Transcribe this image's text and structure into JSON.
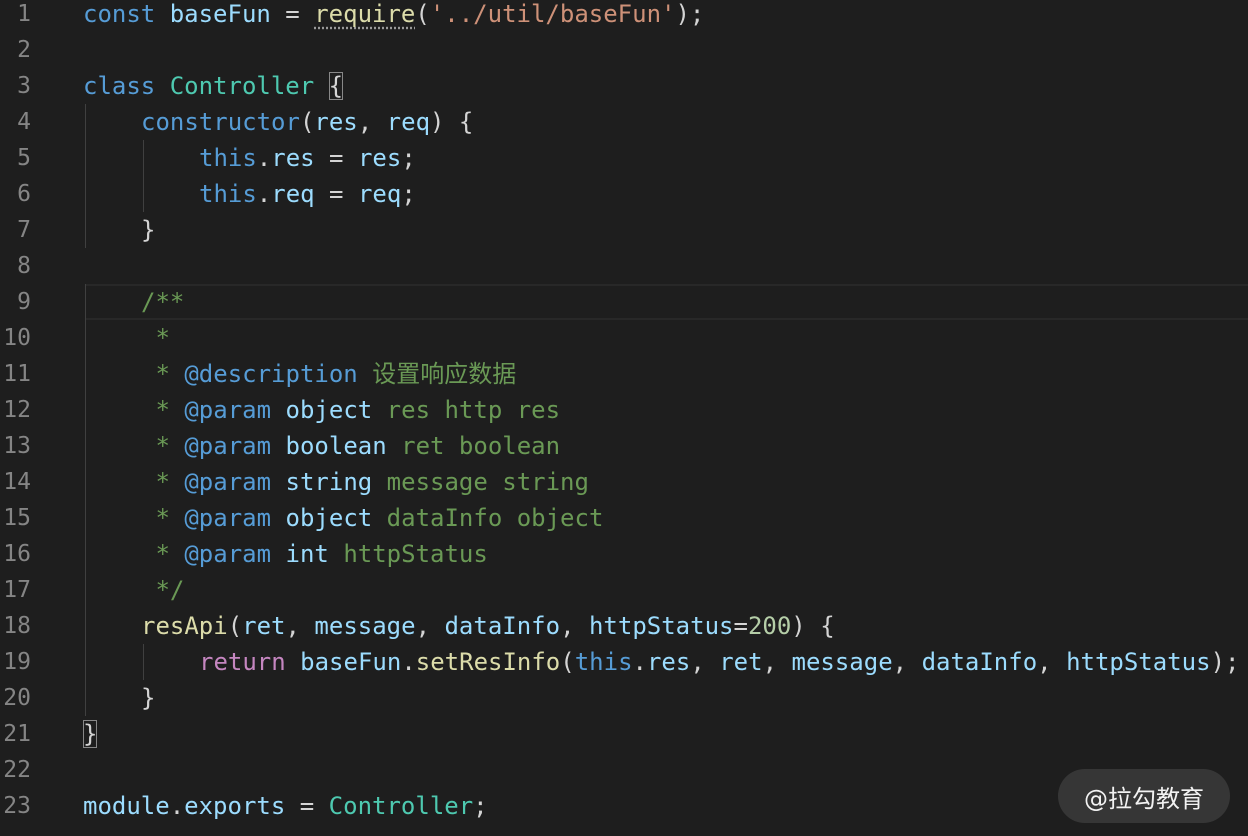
{
  "theme": {
    "background": "#1e1e1e",
    "colors": {
      "plain": "#d4d4d4",
      "keyword": "#569cd6",
      "control": "#c586c0",
      "type": "#4ec9b0",
      "function": "#dcdcaa",
      "string": "#ce9178",
      "variable": "#9cdcfe",
      "number": "#b5cea8",
      "comment": "#6a9955",
      "tag": "#569cd6"
    }
  },
  "editor": {
    "current_line": 9,
    "lines": [
      {
        "n": "1",
        "indent": 0,
        "tokens": [
          {
            "t": "const",
            "k": "keyword"
          },
          {
            "t": " ",
            "k": "plain"
          },
          {
            "t": "baseFun",
            "k": "variable"
          },
          {
            "t": " = ",
            "k": "plain"
          },
          {
            "t": "require",
            "k": "function",
            "dots": true
          },
          {
            "t": "(",
            "k": "plain"
          },
          {
            "t": "'../util/baseFun'",
            "k": "string"
          },
          {
            "t": ");",
            "k": "plain"
          }
        ]
      },
      {
        "n": "2",
        "indent": 0,
        "tokens": []
      },
      {
        "n": "3",
        "indent": 0,
        "tokens": [
          {
            "t": "class",
            "k": "keyword"
          },
          {
            "t": " ",
            "k": "plain"
          },
          {
            "t": "Controller",
            "k": "type"
          },
          {
            "t": " ",
            "k": "plain"
          },
          {
            "t": "{",
            "k": "plain",
            "box": true
          }
        ]
      },
      {
        "n": "4",
        "indent": 1,
        "tokens": [
          {
            "t": "constructor",
            "k": "keyword"
          },
          {
            "t": "(",
            "k": "plain"
          },
          {
            "t": "res",
            "k": "variable"
          },
          {
            "t": ", ",
            "k": "plain"
          },
          {
            "t": "req",
            "k": "variable"
          },
          {
            "t": ") {",
            "k": "plain"
          }
        ]
      },
      {
        "n": "5",
        "indent": 2,
        "tokens": [
          {
            "t": "this",
            "k": "keyword"
          },
          {
            "t": ".",
            "k": "plain"
          },
          {
            "t": "res",
            "k": "variable"
          },
          {
            "t": " = ",
            "k": "plain"
          },
          {
            "t": "res",
            "k": "variable"
          },
          {
            "t": ";",
            "k": "plain"
          }
        ]
      },
      {
        "n": "6",
        "indent": 2,
        "tokens": [
          {
            "t": "this",
            "k": "keyword"
          },
          {
            "t": ".",
            "k": "plain"
          },
          {
            "t": "req",
            "k": "variable"
          },
          {
            "t": " = ",
            "k": "plain"
          },
          {
            "t": "req",
            "k": "variable"
          },
          {
            "t": ";",
            "k": "plain"
          }
        ]
      },
      {
        "n": "7",
        "indent": 1,
        "tokens": [
          {
            "t": "}",
            "k": "plain"
          }
        ]
      },
      {
        "n": "8",
        "indent": 0,
        "tokens": []
      },
      {
        "n": "9",
        "indent": 1,
        "tokens": [
          {
            "t": "/**",
            "k": "comment"
          }
        ]
      },
      {
        "n": "10",
        "indent": 1,
        "tokens": [
          {
            "t": " *",
            "k": "comment"
          }
        ]
      },
      {
        "n": "11",
        "indent": 1,
        "tokens": [
          {
            "t": " * ",
            "k": "comment"
          },
          {
            "t": "@description",
            "k": "tag"
          },
          {
            "t": " 设置响应数据",
            "k": "comment"
          }
        ]
      },
      {
        "n": "12",
        "indent": 1,
        "tokens": [
          {
            "t": " * ",
            "k": "comment"
          },
          {
            "t": "@param",
            "k": "tag"
          },
          {
            "t": " ",
            "k": "comment"
          },
          {
            "t": "object",
            "k": "variable"
          },
          {
            "t": " res http res",
            "k": "comment"
          }
        ]
      },
      {
        "n": "13",
        "indent": 1,
        "tokens": [
          {
            "t": " * ",
            "k": "comment"
          },
          {
            "t": "@param",
            "k": "tag"
          },
          {
            "t": " ",
            "k": "comment"
          },
          {
            "t": "boolean",
            "k": "variable"
          },
          {
            "t": " ret boolean",
            "k": "comment"
          }
        ]
      },
      {
        "n": "14",
        "indent": 1,
        "tokens": [
          {
            "t": " * ",
            "k": "comment"
          },
          {
            "t": "@param",
            "k": "tag"
          },
          {
            "t": " ",
            "k": "comment"
          },
          {
            "t": "string",
            "k": "variable"
          },
          {
            "t": " message string",
            "k": "comment"
          }
        ]
      },
      {
        "n": "15",
        "indent": 1,
        "tokens": [
          {
            "t": " * ",
            "k": "comment"
          },
          {
            "t": "@param",
            "k": "tag"
          },
          {
            "t": " ",
            "k": "comment"
          },
          {
            "t": "object",
            "k": "variable"
          },
          {
            "t": " dataInfo object",
            "k": "comment"
          }
        ]
      },
      {
        "n": "16",
        "indent": 1,
        "tokens": [
          {
            "t": " * ",
            "k": "comment"
          },
          {
            "t": "@param",
            "k": "tag"
          },
          {
            "t": " ",
            "k": "comment"
          },
          {
            "t": "int",
            "k": "variable"
          },
          {
            "t": " httpStatus",
            "k": "comment"
          }
        ]
      },
      {
        "n": "17",
        "indent": 1,
        "tokens": [
          {
            "t": " */",
            "k": "comment"
          }
        ]
      },
      {
        "n": "18",
        "indent": 1,
        "tokens": [
          {
            "t": "resApi",
            "k": "function"
          },
          {
            "t": "(",
            "k": "plain"
          },
          {
            "t": "ret",
            "k": "variable"
          },
          {
            "t": ", ",
            "k": "plain"
          },
          {
            "t": "message",
            "k": "variable"
          },
          {
            "t": ", ",
            "k": "plain"
          },
          {
            "t": "dataInfo",
            "k": "variable"
          },
          {
            "t": ", ",
            "k": "plain"
          },
          {
            "t": "httpStatus",
            "k": "variable"
          },
          {
            "t": "=",
            "k": "plain"
          },
          {
            "t": "200",
            "k": "number"
          },
          {
            "t": ") {",
            "k": "plain"
          }
        ]
      },
      {
        "n": "19",
        "indent": 2,
        "tokens": [
          {
            "t": "return",
            "k": "control"
          },
          {
            "t": " ",
            "k": "plain"
          },
          {
            "t": "baseFun",
            "k": "variable"
          },
          {
            "t": ".",
            "k": "plain"
          },
          {
            "t": "setResInfo",
            "k": "function"
          },
          {
            "t": "(",
            "k": "plain"
          },
          {
            "t": "this",
            "k": "keyword"
          },
          {
            "t": ".",
            "k": "plain"
          },
          {
            "t": "res",
            "k": "variable"
          },
          {
            "t": ", ",
            "k": "plain"
          },
          {
            "t": "ret",
            "k": "variable"
          },
          {
            "t": ", ",
            "k": "plain"
          },
          {
            "t": "message",
            "k": "variable"
          },
          {
            "t": ", ",
            "k": "plain"
          },
          {
            "t": "dataInfo",
            "k": "variable"
          },
          {
            "t": ", ",
            "k": "plain"
          },
          {
            "t": "httpStatus",
            "k": "variable"
          },
          {
            "t": ");",
            "k": "plain"
          }
        ]
      },
      {
        "n": "20",
        "indent": 1,
        "tokens": [
          {
            "t": "}",
            "k": "plain"
          }
        ]
      },
      {
        "n": "21",
        "indent": 0,
        "tokens": [
          {
            "t": "}",
            "k": "plain",
            "box": true
          }
        ]
      },
      {
        "n": "22",
        "indent": 0,
        "tokens": []
      },
      {
        "n": "23",
        "indent": 0,
        "tokens": [
          {
            "t": "module",
            "k": "variable"
          },
          {
            "t": ".",
            "k": "plain"
          },
          {
            "t": "exports",
            "k": "variable"
          },
          {
            "t": " = ",
            "k": "plain"
          },
          {
            "t": "Controller",
            "k": "type"
          },
          {
            "t": ";",
            "k": "plain"
          }
        ]
      }
    ]
  },
  "watermark": {
    "text": "@拉勾教育"
  }
}
